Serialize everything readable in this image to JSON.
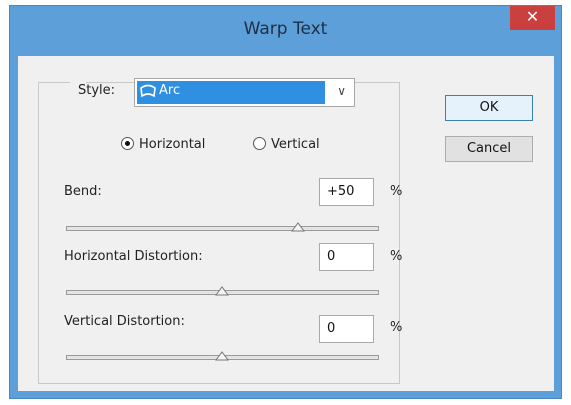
{
  "window": {
    "title": "Warp Text",
    "close_glyph": "✕"
  },
  "style": {
    "label": "Style:",
    "selected": "Arc",
    "icon": "arc-icon"
  },
  "orientation": {
    "options": [
      {
        "label": "Horizontal",
        "checked": true
      },
      {
        "label": "Vertical",
        "checked": false
      }
    ]
  },
  "bend": {
    "label": "Bend:",
    "value": "+50",
    "unit": "%",
    "level": 0.75
  },
  "horizontal_distortion": {
    "label": "Horizontal Distortion:",
    "value": "0",
    "unit": "%",
    "level": 0.5
  },
  "vertical_distortion": {
    "label": "Vertical Distortion:",
    "value": "0",
    "unit": "%",
    "level": 0.5
  },
  "buttons": {
    "ok": "OK",
    "cancel": "Cancel"
  }
}
